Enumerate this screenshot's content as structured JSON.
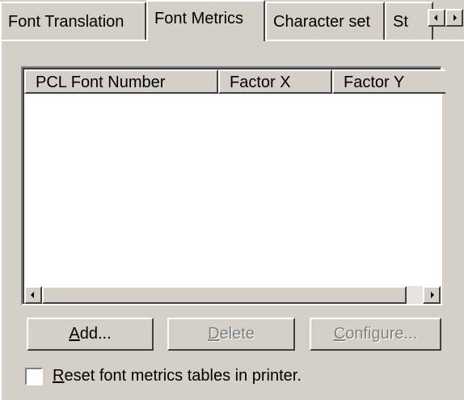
{
  "tabs": [
    {
      "label": "Font Translation",
      "active": false
    },
    {
      "label": "Font Metrics",
      "active": true
    },
    {
      "label": "Character set",
      "active": false
    },
    {
      "label": "St",
      "active": false
    }
  ],
  "list": {
    "columns": [
      "PCL Font Number",
      "Factor X",
      "Factor Y"
    ],
    "rows": []
  },
  "buttons": {
    "add_prefix": "",
    "add_mnemonic": "A",
    "add_rest": "dd...",
    "delete_prefix": "",
    "delete_mnemonic": "D",
    "delete_rest": "elete",
    "configure_prefix": "",
    "configure_mnemonic": "C",
    "configure_rest": "onfigure..."
  },
  "checkbox": {
    "mnemonic": "R",
    "rest": "eset font metrics tables in printer.",
    "checked": false
  }
}
